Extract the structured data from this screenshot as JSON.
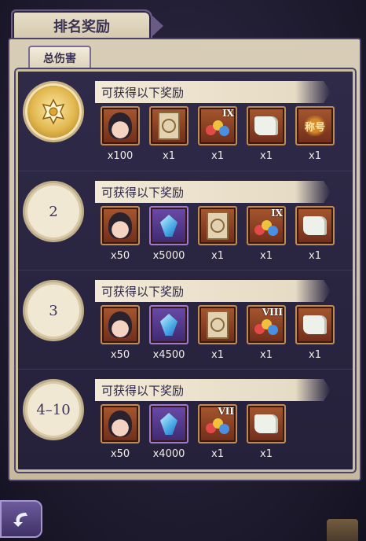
{
  "header": {
    "title": "排名奖励"
  },
  "tabs": [
    {
      "label": "总伤害",
      "selected": true
    }
  ],
  "tiers": [
    {
      "rank_label": "",
      "rank_badge": "gold-crest-icon",
      "heading": "可获得以下奖励",
      "rewards": [
        {
          "icon": "character-shard-icon",
          "qty": "x100"
        },
        {
          "icon": "card-ticket-icon",
          "qty": "x1"
        },
        {
          "icon": "gem-pack-ix-icon",
          "qty": "x1",
          "tag": "IX"
        },
        {
          "icon": "scroll-icon",
          "qty": "x1"
        },
        {
          "icon": "title-emblem-icon",
          "qty": "x1",
          "tag": "称号"
        }
      ]
    },
    {
      "rank_label": "2",
      "heading": "可获得以下奖励",
      "rewards": [
        {
          "icon": "character-shard-icon",
          "qty": "x50"
        },
        {
          "icon": "blue-crystal-icon",
          "qty": "x5000"
        },
        {
          "icon": "card-ticket-icon",
          "qty": "x1"
        },
        {
          "icon": "gem-pack-ix-icon",
          "qty": "x1",
          "tag": "IX"
        },
        {
          "icon": "scroll-icon",
          "qty": "x1"
        }
      ]
    },
    {
      "rank_label": "3",
      "heading": "可获得以下奖励",
      "rewards": [
        {
          "icon": "character-shard-icon",
          "qty": "x50"
        },
        {
          "icon": "blue-crystal-icon",
          "qty": "x4500"
        },
        {
          "icon": "card-ticket-icon",
          "qty": "x1"
        },
        {
          "icon": "gem-pack-viii-icon",
          "qty": "x1",
          "tag": "VIII"
        },
        {
          "icon": "scroll-icon",
          "qty": "x1"
        }
      ]
    },
    {
      "rank_label": "4–10",
      "heading": "可获得以下奖励",
      "rewards": [
        {
          "icon": "character-shard-icon",
          "qty": "x50"
        },
        {
          "icon": "blue-crystal-icon",
          "qty": "x4000"
        },
        {
          "icon": "gem-pack-vii-icon",
          "qty": "x1",
          "tag": "VII"
        },
        {
          "icon": "scroll-icon",
          "qty": "x1"
        }
      ]
    }
  ],
  "colors": {
    "panel": "#2e2a48",
    "ribbon": "#f2e9d6",
    "item_border": "#c08a55",
    "purple_item": "#6b4aa8"
  }
}
